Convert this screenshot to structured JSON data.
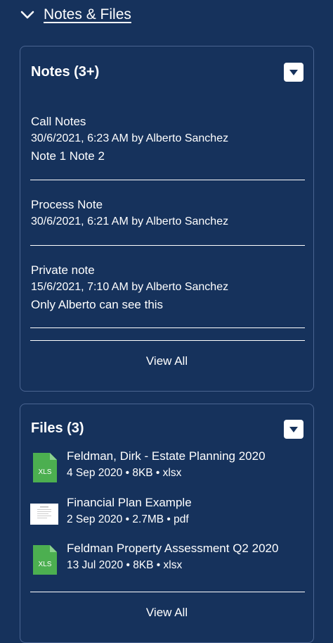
{
  "section": {
    "title": "Notes & Files",
    "icon": "chevron-down-icon"
  },
  "notes_card": {
    "title": "Notes (3+)",
    "items": [
      {
        "title": "Call Notes",
        "meta": "30/6/2021, 6:23 AM by Alberto Sanchez",
        "body": "Note 1 Note 2"
      },
      {
        "title": "Process Note",
        "meta": "30/6/2021, 6:21 AM by Alberto Sanchez",
        "body": ""
      },
      {
        "title": "Private note",
        "meta": "15/6/2021, 7:10 AM by Alberto Sanchez",
        "body": "Only Alberto can see this"
      }
    ],
    "view_all": "View All"
  },
  "files_card": {
    "title": "Files (3)",
    "items": [
      {
        "name": "Feldman, Dirk - Estate Planning 2020",
        "meta": "4 Sep 2020 • 8KB • xlsx",
        "icon": "xls-file-icon",
        "icon_label": "XLS"
      },
      {
        "name": "Financial Plan Example",
        "meta": "2 Sep 2020 • 2.7MB • pdf",
        "icon": "pdf-thumbnail-icon",
        "icon_label": ""
      },
      {
        "name": "Feldman Property Assessment Q2 2020",
        "meta": "13 Jul 2020 • 8KB • xlsx",
        "icon": "xls-file-icon",
        "icon_label": "XLS"
      }
    ],
    "view_all": "View All"
  },
  "colors": {
    "background": "#16325c",
    "card_border": "#4a6491",
    "xls_green": "#4caf50",
    "text": "#ffffff"
  }
}
